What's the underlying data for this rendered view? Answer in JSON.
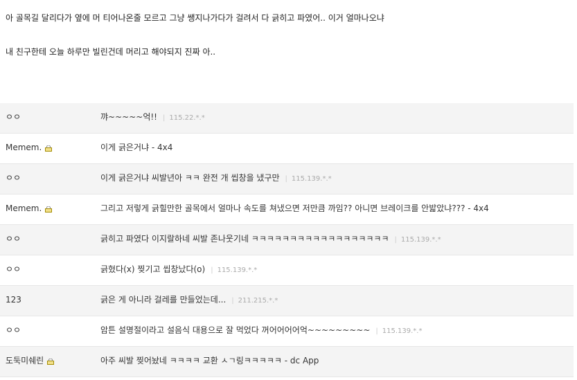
{
  "post": {
    "lines": [
      "아 골목길 달리다가 옆에 머 티어나온줄 모르고 그냥 쌩지나가다가 걸려서 다 긁히고 파였어.. 이거 얼마나오냐",
      "내 친구한테 오늘 하루만 빌린건데 머리고 해야되지 진짜 아.."
    ]
  },
  "comments": [
    {
      "nick": "ㅇㅇ",
      "lock": false,
      "text": "꺄~~~~~억!!",
      "ip": "115.22.*.*"
    },
    {
      "nick": "Memem.",
      "lock": true,
      "text": "이게 긁은거냐 - 4x4",
      "ip": ""
    },
    {
      "nick": "ㅇㅇ",
      "lock": false,
      "text": "이게 긁은거냐 씨발년아 ㅋㅋ 완전 개 씹창을 냈구만",
      "ip": "115.139.*.*"
    },
    {
      "nick": "Memem.",
      "lock": true,
      "text": "그리고 저렇게 긁힐만한 골목에서 얼마나 속도를 쳐냈으면 저만큼 까임?? 아니면 브레이크를 안밟았냐??? - 4x4",
      "ip": ""
    },
    {
      "nick": "ㅇㅇ",
      "lock": false,
      "text": "긁히고 파였다 이지랄하네 씨발 존나웃기네 ㅋㅋㅋㅋㅋㅋㅋㅋㅋㅋㅋㅋㅋㅋㅋㅋㅋㅋ",
      "ip": "115.139.*.*"
    },
    {
      "nick": "ㅇㅇ",
      "lock": false,
      "text": "긁혔다(x) 찢기고 씹창났다(o)",
      "ip": "115.139.*.*"
    },
    {
      "nick": "123",
      "lock": false,
      "text": "긁은 게 아니라 걸레를 만들었는데...",
      "ip": "211.215.*.*"
    },
    {
      "nick": "ㅇㅇ",
      "lock": false,
      "text": "암튼 설명절이라고 설음식 대용으로 잘 먹었다 꺼어어어어억~~~~~~~~~",
      "ip": "115.139.*.*"
    },
    {
      "nick": "도둑미쉐린",
      "lock": true,
      "text": "아주 씨발 찢어놨네 ㅋㅋㅋㅋ 교환 ㅅㄱ링ㅋㅋㅋㅋㅋ - dc App",
      "ip": ""
    }
  ],
  "colors": {
    "row_shade": "#f4f4f4",
    "ip": "#aaaaaa",
    "lock_icon": "#d9b800"
  },
  "icons": {
    "lock": "lock-icon"
  }
}
